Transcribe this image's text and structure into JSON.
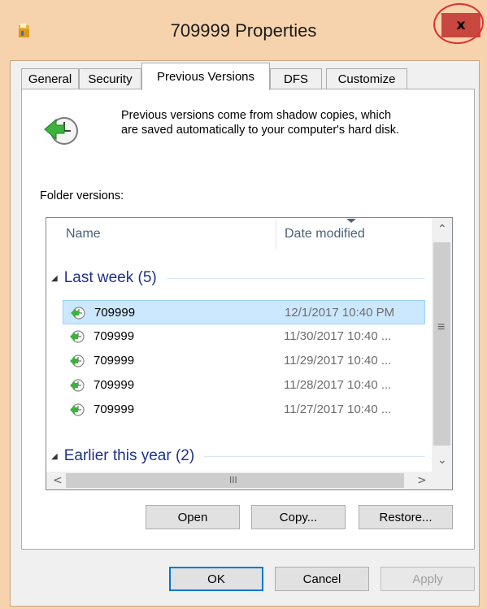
{
  "window": {
    "title": "709999 Properties",
    "close_label": "x"
  },
  "tabs": [
    {
      "label": "General"
    },
    {
      "label": "Security"
    },
    {
      "label": "Previous Versions",
      "active": true
    },
    {
      "label": "DFS"
    },
    {
      "label": "Customize"
    }
  ],
  "info": {
    "line1": "Previous versions come from shadow copies, which",
    "line2": "are saved automatically to your computer's hard disk."
  },
  "folder_versions_label": "Folder versions:",
  "list": {
    "columns": {
      "name": "Name",
      "date": "Date modified"
    },
    "groups": [
      {
        "label": "Last week (5)",
        "items": [
          {
            "name": "709999",
            "date": "12/1/2017 10:40 PM",
            "selected": true
          },
          {
            "name": "709999",
            "date": "11/30/2017 10:40 ..."
          },
          {
            "name": "709999",
            "date": "11/29/2017 10:40 ..."
          },
          {
            "name": "709999",
            "date": "11/28/2017 10:40 ..."
          },
          {
            "name": "709999",
            "date": "11/27/2017 10:40 ..."
          }
        ]
      },
      {
        "label": "Earlier this year (2)",
        "items": []
      }
    ],
    "hscroll_grip": "III"
  },
  "panel_buttons": {
    "open": "Open",
    "copy": "Copy...",
    "restore": "Restore..."
  },
  "dialog_buttons": {
    "ok": "OK",
    "cancel": "Cancel",
    "apply": "Apply"
  },
  "colors": {
    "title_bg": "#f6d3ac",
    "close_bg": "#c8473f",
    "selection": "#cce8ff",
    "group_text": "#1e3287",
    "annotation": "#e03030"
  },
  "icons": [
    "folder-icon",
    "close-icon",
    "restore-clock-icon",
    "sort-arrow-icon",
    "scroll-up-icon",
    "scroll-down-icon",
    "scroll-left-icon",
    "scroll-right-icon"
  ]
}
